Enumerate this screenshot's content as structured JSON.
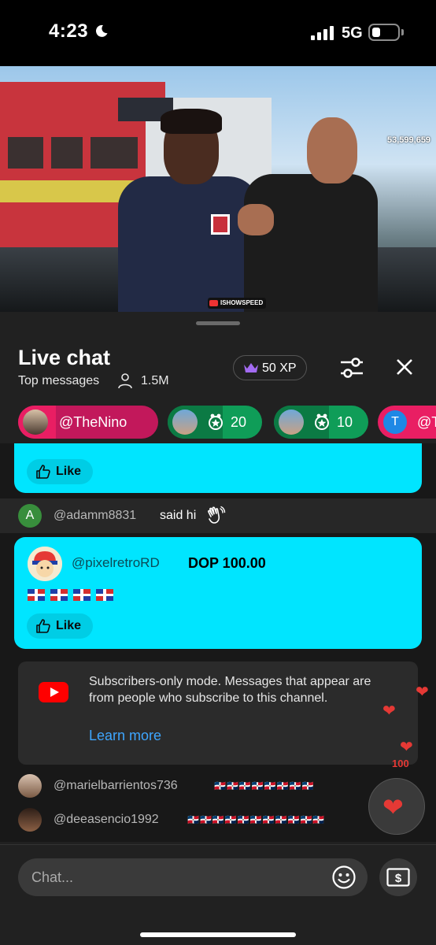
{
  "status_bar": {
    "time": "4:23",
    "network": "5G"
  },
  "video": {
    "viewer_overlay": "53,599,659",
    "watermark": "ISHOWSPEED"
  },
  "chat": {
    "title": "Live chat",
    "mode": "Top messages",
    "viewers": "1.5M",
    "xp": "50 XP",
    "ticker": [
      {
        "label": "@TheNino",
        "color": "#e91e63"
      },
      {
        "label": "20",
        "color": "#0f9d58"
      },
      {
        "label": "10",
        "color": "#0f9d58"
      },
      {
        "label": "@T",
        "avatar_letter": "T",
        "color": "#e91e63"
      }
    ],
    "messages": {
      "top_card_like": "Like",
      "adam": {
        "avatar_letter": "A",
        "author": "@adamm8831",
        "text": "said hi"
      },
      "superchat": {
        "author": "@pixelretroRD",
        "amount": "DOP 100.00",
        "flags": "🇩🇴 🇩🇴 🇩🇴 🇩🇴",
        "like": "Like",
        "color": "#00e5ff"
      },
      "notice": {
        "text": "Subscribers-only mode. Messages that appear are from people who subscribe to this channel.",
        "link": "Learn more"
      },
      "mariel": {
        "author": "@marielbarrientos736",
        "text": "🇩🇴🇩🇴🇩🇴🇩🇴🇩🇴🇩🇴🇩🇴🇩🇴"
      },
      "deea": {
        "author": "@deeasencio1992",
        "text": "🇩🇴🇩🇴🇩🇴🇩🇴🇩🇴🇩🇴🇩🇴🇩🇴🇩🇴🇩🇴🇩🇴"
      }
    },
    "reaction_label": "100",
    "input_placeholder": "Chat..."
  }
}
